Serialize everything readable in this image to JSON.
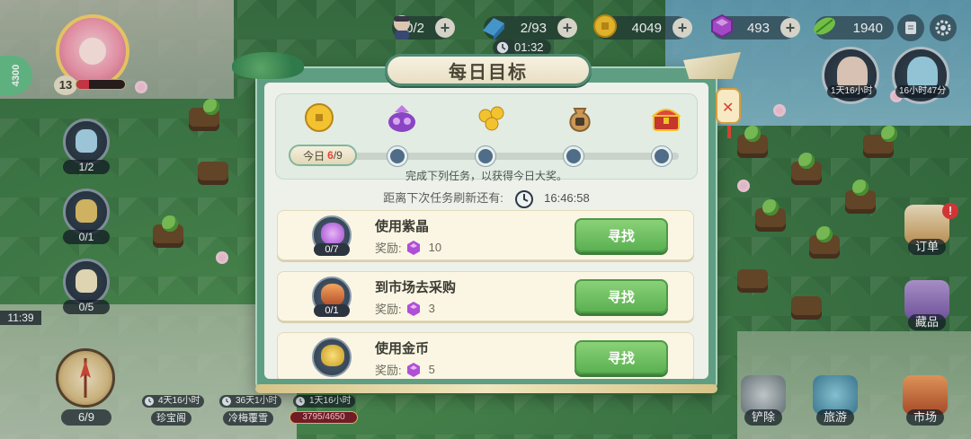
{
  "resources": {
    "workers": "0/2",
    "blocks": "2/93",
    "coins": "4049",
    "gems": "493",
    "leaves": "1940",
    "timer": "01:32"
  },
  "player": {
    "level": "13",
    "side_count": "4300",
    "level_progress": 0.25
  },
  "left_slots": [
    {
      "value": "1/2"
    },
    {
      "value": "0/1"
    },
    {
      "value": "0/5"
    }
  ],
  "left_time": "11:39",
  "compass_label": "6/9",
  "buildings": [
    {
      "timer": "4天16小时",
      "name": "珍宝阁"
    },
    {
      "timer": "36天1小时",
      "name": "冷梅覆雪"
    },
    {
      "timer": "1天16小时",
      "progress": "3795/4650"
    }
  ],
  "right_slots": [
    {
      "timer": "1天16小时"
    },
    {
      "timer": "16小时47分"
    }
  ],
  "right_buttons": {
    "orders": "订单",
    "collection": "藏品",
    "shovel": "铲除",
    "travel": "旅游",
    "market": "市场"
  },
  "modal": {
    "title": "每日目标",
    "today_label": "今日",
    "today_done": "6",
    "today_total": "/9",
    "hint": "完成下列任务，以获得今日大奖。",
    "refresh_label": "距离下次任务刷新还有:",
    "refresh_time": "16:46:58",
    "reward_labels": "奖励:",
    "tasks": [
      {
        "name": "使用紫晶",
        "count": "0/7",
        "reward": "10",
        "button": "寻找"
      },
      {
        "name": "到市场去采购",
        "count": "0/1",
        "reward": "3",
        "button": "寻找"
      },
      {
        "name": "使用金币",
        "count": "",
        "reward": "5",
        "button": "寻找"
      }
    ]
  },
  "colors": {
    "accent_green": "#5bb152",
    "gem_purple": "#b04fd6",
    "coin_gold": "#f2c230",
    "alert_red": "#e23b3b"
  }
}
